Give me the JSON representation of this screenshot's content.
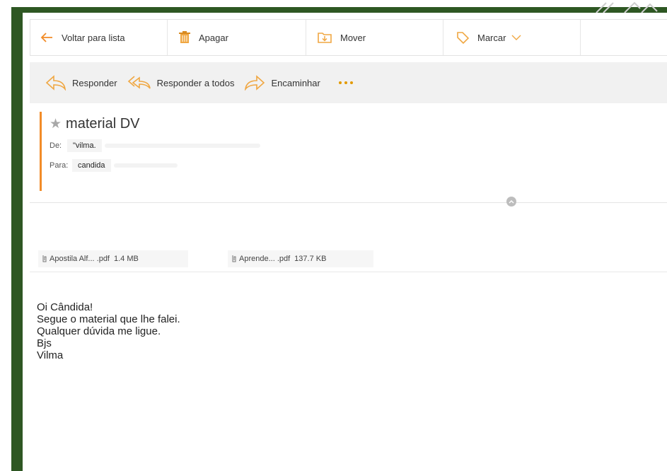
{
  "toolbar": {
    "back_label": "Voltar para lista",
    "delete_label": "Apagar",
    "move_label": "Mover",
    "mark_label": "Marcar"
  },
  "actions": {
    "reply_label": "Responder",
    "reply_all_label": "Responder a todos",
    "forward_label": "Encaminhar"
  },
  "message": {
    "subject": "material DV",
    "from_label": "De:",
    "from_value": "\"vilma.",
    "to_label": "Para:",
    "to_value": "candida"
  },
  "attachments": [
    {
      "name": "Apostila Alf... .pdf",
      "size": "1.4 MB"
    },
    {
      "name": "Aprende... .pdf",
      "size": "137.7 KB"
    }
  ],
  "body_lines": [
    "Oi Cândida!",
    "Segue o material que lhe falei.",
    "Qualquer dúvida me ligue.",
    "Bjs",
    "Vilma"
  ],
  "colors": {
    "frame_green": "#2e5723",
    "accent_orange": "#f28c28",
    "dots_orange": "#e39a00",
    "icon_orange": "#f0a742"
  }
}
